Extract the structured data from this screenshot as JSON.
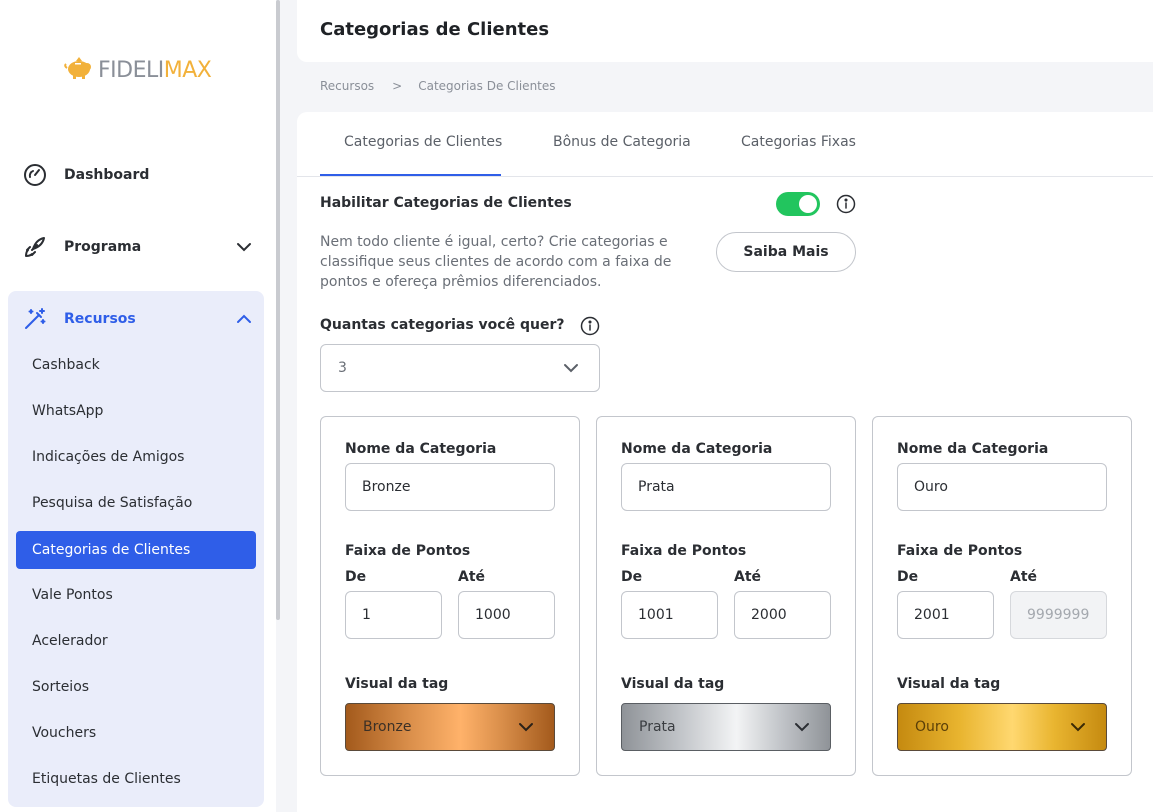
{
  "sidebar": {
    "logo": {
      "part1": "FIDELI",
      "part2": "MAX"
    },
    "nav": {
      "dashboard": "Dashboard",
      "programa": "Programa",
      "recursos": "Recursos"
    },
    "recursos_items": [
      "Cashback",
      "WhatsApp",
      "Indicações de Amigos",
      "Pesquisa de Satisfação",
      "Categorias de Clientes",
      "Vale Pontos",
      "Acelerador",
      "Sorteios",
      "Vouchers",
      "Etiquetas de Clientes"
    ],
    "active_item": "Categorias de Clientes"
  },
  "header": {
    "title": "Categorias de Clientes"
  },
  "breadcrumb": {
    "root": "Recursos",
    "separator": ">",
    "current": "Categorias De Clientes"
  },
  "tabs": [
    {
      "label": "Categorias de Clientes",
      "active": true
    },
    {
      "label": "Bônus de Categoria",
      "active": false
    },
    {
      "label": "Categorias Fixas",
      "active": false
    }
  ],
  "settings": {
    "enable_label": "Habilitar Categorias de Clientes",
    "enabled": true,
    "description": "Nem todo cliente é igual, certo? Crie categorias e classifique seus clientes de acordo com a faixa de pontos e ofereça prêmios diferenciados.",
    "saiba_mais": "Saiba Mais",
    "count_label": "Quantas categorias você quer?",
    "count_value": "3"
  },
  "labels": {
    "name": "Nome da Categoria",
    "range": "Faixa de Pontos",
    "from": "De",
    "to": "Até",
    "tag": "Visual da tag"
  },
  "categories": [
    {
      "name": "Bronze",
      "from": "1",
      "to": "1000",
      "tag": "Bronze"
    },
    {
      "name": "Prata",
      "from": "1001",
      "to": "2000",
      "tag": "Prata"
    },
    {
      "name": "Ouro",
      "from": "2001",
      "to_placeholder": "9999999",
      "tag": "Ouro"
    }
  ],
  "colors": {
    "accent": "#2f5ee8",
    "toggle_on": "#22c55e",
    "logo_gold": "#f2b13a"
  }
}
